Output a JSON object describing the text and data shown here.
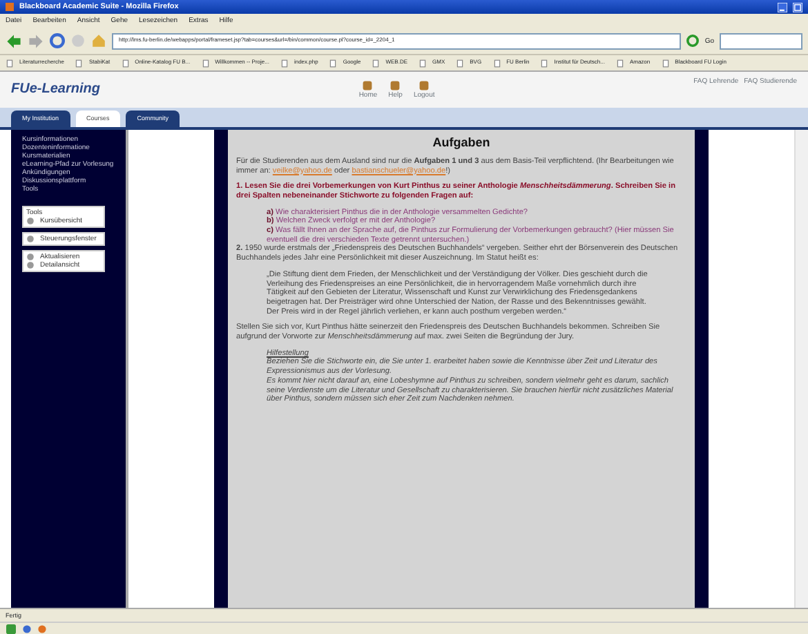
{
  "window": {
    "title": "Blackboard Academic Suite - Mozilla Firefox"
  },
  "menu": [
    "Datei",
    "Bearbeiten",
    "Ansicht",
    "Gehe",
    "Lesezeichen",
    "Extras",
    "Hilfe"
  ],
  "address_bar": {
    "url": "http://lms.fu-berlin.de/webapps/portal/frameset.jsp?tab=courses&url=/bin/common/course.pl?course_id=_2204_1",
    "go": "Go"
  },
  "bookmarks": [
    {
      "label": "Literaturrecherche"
    },
    {
      "label": "StabiKat"
    },
    {
      "label": "Online-Katalog FU B..."
    },
    {
      "label": "Willkommen -- Proje..."
    },
    {
      "label": "index.php"
    },
    {
      "label": "Google"
    },
    {
      "label": "WEB.DE"
    },
    {
      "label": "GMX"
    },
    {
      "label": "BVG"
    },
    {
      "label": "FU Berlin"
    },
    {
      "label": "Institut für Deutsch..."
    },
    {
      "label": "Amazon"
    },
    {
      "label": "Blackboard FU Login"
    }
  ],
  "portal": {
    "logo": "FUe-Learning",
    "nav": [
      "Home",
      "Help",
      "Logout"
    ],
    "faq": [
      "FAQ Lehrende",
      "FAQ Studierende"
    ]
  },
  "tabs": [
    {
      "label": "My Institution",
      "selected": false
    },
    {
      "label": "Courses",
      "selected": true
    },
    {
      "label": "Community",
      "selected": false
    }
  ],
  "sidebar": {
    "items": [
      "Kursinformationen",
      "Dozenteninformatione",
      "Kursmaterialien",
      "eLearning-Pfad zur Vorlesung",
      "Ankündigungen",
      "Diskussionsplattform",
      "Tools"
    ],
    "panels": [
      [
        {
          "kind": "header",
          "label": "Tools"
        },
        {
          "kind": "link",
          "label": "Kursübersicht"
        }
      ],
      [
        {
          "kind": "link",
          "label": "Steuerungsfenster"
        }
      ],
      [
        {
          "kind": "link",
          "label": "Aktualisieren"
        },
        {
          "kind": "link",
          "label": "Detailansicht"
        }
      ]
    ]
  },
  "content": {
    "title": "Aufgaben",
    "blocks": [
      {
        "kind": "linked",
        "parts": [
          {
            "text": "Für die Studierenden aus dem Ausland sind nur die **Aufgaben 1 und 3** aus dem Basis-Teil verpflichtend. (Ihr Bearbeitungen wie immer an: "
          },
          {
            "link": "veilke@yahoo.de"
          },
          {
            "text": " oder "
          },
          {
            "link": "bastianschueler@yahoo.de"
          },
          {
            "text": "!)"
          }
        ]
      },
      {
        "kind": "question",
        "text": "1. Lesen Sie die drei Vorbemerkungen von Kurt Pinthus zu seiner Anthologie *Menschheitsdämmerung*. Schreiben Sie in drei Spalten nebeneinander Stichworte zu folgenden Fragen auf:"
      },
      {
        "kind": "sub",
        "text": "**a)** Wie charakterisiert Pinthus die in der Anthologie versammelten Gedichte?"
      },
      {
        "kind": "sub",
        "text": "**b)** Welchen Zweck verfolgt er mit der Anthologie?"
      },
      {
        "kind": "sub",
        "text": "**c)** Was fällt Ihnen an der Sprache auf, die Pinthus zur Formulierung der Vorbemerkungen gebraucht? (Hier müssen Sie eventuell die drei verschieden Texte getrennt untersuchen.)"
      },
      {
        "kind": "paragraph",
        "text": "**2.** 1950 wurde erstmals der „Friedenspreis des Deutschen Buchhandels“ vergeben. Seither ehrt der Börsenverein des Deutschen Buchhandels jedes Jahr eine Persönlichkeit mit dieser Auszeichnung. Im Statut heißt es:"
      },
      {
        "kind": "quote",
        "text": "„Die Stiftung dient dem Frieden, der Menschlichkeit und der Verständigung der Völker. Dies geschieht durch die Verleihung des Friedenspreises an eine Persönlichkeit, die in hervorragendem Maße vornehmlich durch ihre Tätigkeit auf den Gebieten der Literatur, Wissenschaft und Kunst zur Verwirklichung des Friedensgedankens beigetragen hat. Der Preisträger wird ohne Unterschied der Nation, der Rasse und des Bekenntnisses gewählt. Der Preis wird in der Regel jährlich verliehen, er kann auch posthum vergeben werden.“"
      },
      {
        "kind": "paragraph",
        "text": "Stellen Sie sich vor, Kurt Pinthus hätte seinerzeit den Friedenspreis des Deutschen Buchhandels bekommen. Schreiben Sie aufgrund der Vorworte zur *Menschheitsdämmerung* auf max. zwei Seiten die Begründung der Jury."
      },
      {
        "kind": "hint_heading",
        "text": "Hilfestellung"
      },
      {
        "kind": "hint",
        "text": "Beziehen Sie die Stichworte ein, die Sie unter 1. erarbeitet haben sowie die Kenntnisse über Zeit und Literatur des Expressionismus aus der Vorlesung."
      },
      {
        "kind": "hint",
        "text": "Es kommt hier nicht darauf an, eine Lobeshymne auf Pinthus zu schreiben, sondern vielmehr geht es darum, sachlich seine Verdienste um die Literatur und Gesellschaft zu charakterisieren. Sie brauchen hierfür nicht zusätzliches Material über Pinthus, sondern müssen sich eher Zeit zum Nachdenken nehmen."
      }
    ]
  },
  "status_bar": {
    "text": "Fertig"
  }
}
